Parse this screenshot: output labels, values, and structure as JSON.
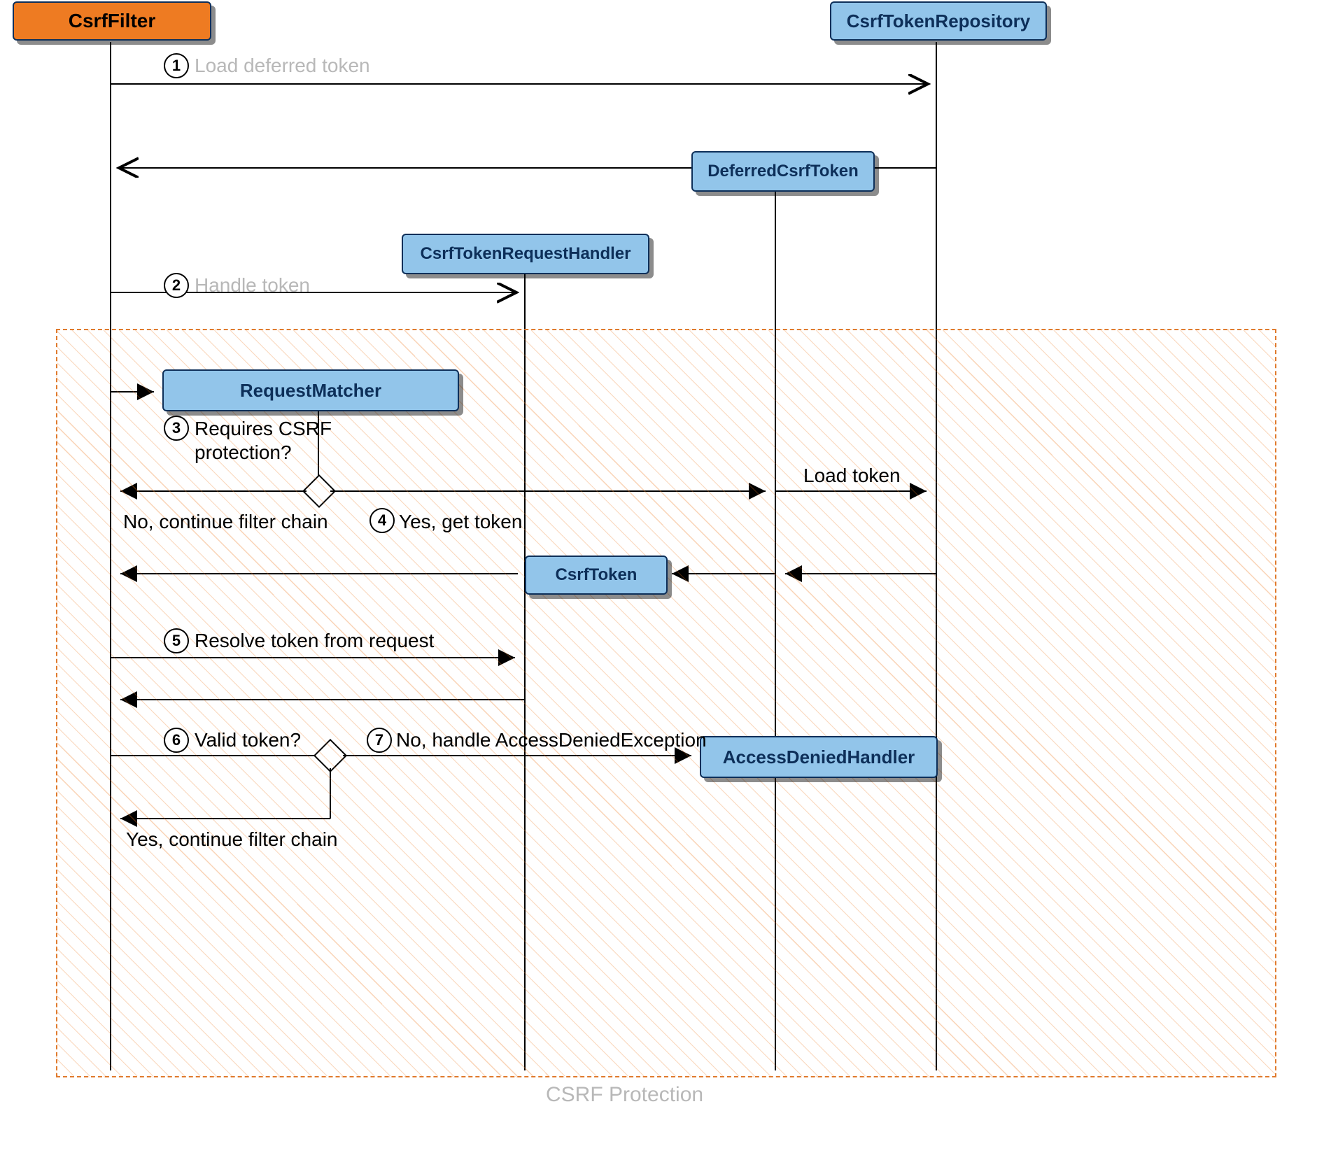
{
  "colors": {
    "orange": "#ee7b22",
    "blue": "#92c5ea",
    "border": "#0d2f59",
    "arrow": "#000000",
    "hatch": "#e07b2e",
    "greyText": "#b8b8b8"
  },
  "boxes": {
    "csrfFilter": "CsrfFilter",
    "csrfTokenRepository": "CsrfTokenRepository",
    "deferredCsrfToken": "DeferredCsrfToken",
    "csrfTokenRequestHandler": "CsrfTokenRequestHandler",
    "requestMatcher": "RequestMatcher",
    "csrfToken": "CsrfToken",
    "accessDeniedHandler": "AccessDeniedHandler"
  },
  "steps": {
    "s1": "Load deferred token",
    "s2": "Handle token",
    "s3": "Requires CSRF\nprotection?",
    "s4": "Yes, get token",
    "s4load": "Load token",
    "s4no": "No, continue filter chain",
    "s5": "Resolve token from request",
    "s6": "Valid token?",
    "s7": "No, handle AccessDeniedException",
    "s7yes": "Yes, continue filter chain"
  },
  "badges": {
    "b1": "1",
    "b2": "2",
    "b3": "3",
    "b4": "4",
    "b5": "5",
    "b6": "6",
    "b7": "7"
  },
  "footer": "CSRF Protection"
}
